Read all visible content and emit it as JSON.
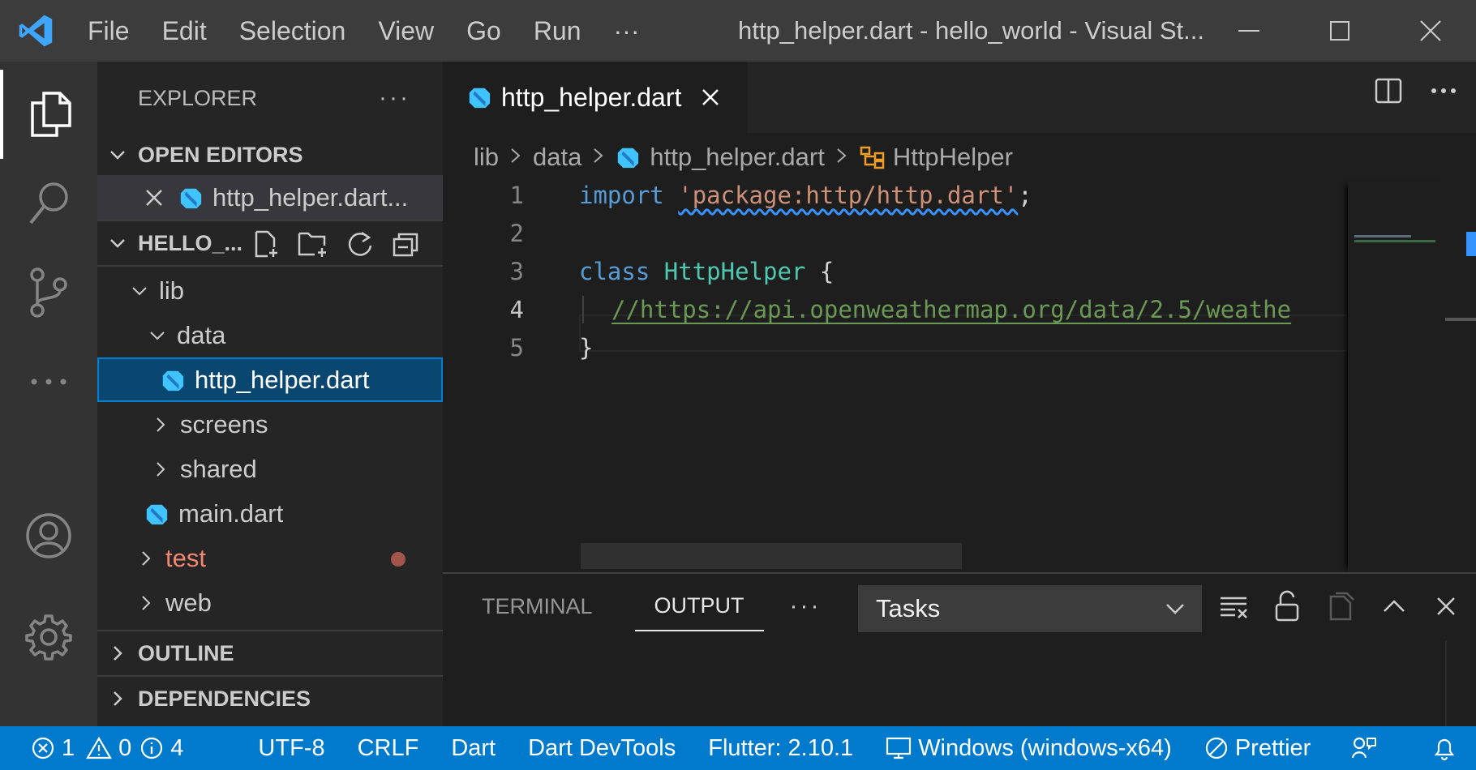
{
  "titlebar": {
    "menu": [
      "File",
      "Edit",
      "Selection",
      "View",
      "Go",
      "Run",
      "···"
    ],
    "window_title": "http_helper.dart - hello_world - Visual St..."
  },
  "sidebar": {
    "header": "EXPLORER",
    "more": "···",
    "open_editors_label": "OPEN EDITORS",
    "open_editor_file": "http_helper.dart...",
    "project_label": "HELLO_...",
    "tree": {
      "lib": "lib",
      "data": "data",
      "http_helper": "http_helper.dart",
      "screens": "screens",
      "shared": "shared",
      "main": "main.dart",
      "test": "test",
      "web": "web"
    },
    "outline_label": "OUTLINE",
    "dependencies_label": "DEPENDENCIES"
  },
  "editor": {
    "tab_label": "http_helper.dart",
    "breadcrumb": [
      "lib",
      "data",
      "http_helper.dart",
      "HttpHelper"
    ],
    "line_numbers": [
      "1",
      "2",
      "3",
      "4",
      "5"
    ],
    "code": {
      "l1_kw": "import",
      "l1_str": "'package:http/http.dart'",
      "l1_end": ";",
      "l3_kw": "class",
      "l3_cls": "HttpHelper",
      "l3_brace": " {",
      "l4_comment": "//https://api.openweathermap.org/data/2.5/weathe",
      "l5": "}"
    }
  },
  "panel": {
    "tabs": [
      "TERMINAL",
      "OUTPUT"
    ],
    "more": "···",
    "tasks_value": "Tasks"
  },
  "statusbar": {
    "errors": "1",
    "warnings": "0",
    "infos": "4",
    "encoding": "UTF-8",
    "eol": "CRLF",
    "language": "Dart",
    "devtools": "Dart DevTools",
    "flutter": "Flutter: 2.10.1",
    "device": "Windows (windows-x64)",
    "prettier": "Prettier"
  },
  "colors": {
    "accent": "#007acc",
    "keyword": "#569cd6",
    "string": "#ce9178",
    "class": "#4ec9b0",
    "comment": "#6a9955",
    "test_folder": "#f48771"
  }
}
